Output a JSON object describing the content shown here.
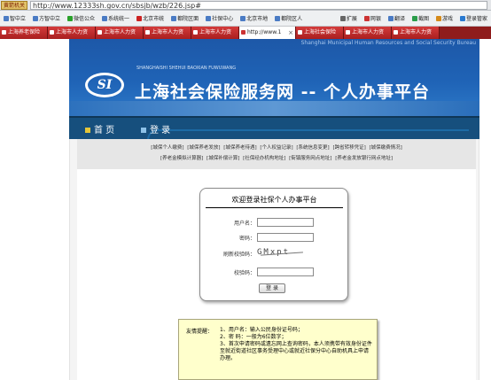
{
  "browser": {
    "badge": "黄箭机关",
    "url": "http://www.12333sh.gov.cn/sbsjb/wzb/226.jsp#"
  },
  "favorites": {
    "left": [
      "智中立",
      "方智中立",
      "微信公众",
      "系统统一",
      "北京市统",
      "都院区面",
      "社保中心",
      "北京市地",
      "都院区人"
    ],
    "right": [
      "扩展",
      "网银",
      "翻译",
      "截图",
      "游戏",
      "登录管家"
    ]
  },
  "tabs": [
    {
      "label": "上海养老保险"
    },
    {
      "label": "上海市人力资"
    },
    {
      "label": "上海市人力资"
    },
    {
      "label": "上海市人力资"
    },
    {
      "label": "上海市人力资"
    },
    {
      "label": "http://www.1"
    },
    {
      "label": "上海社会保险"
    },
    {
      "label": "上海市人力资"
    },
    {
      "label": "上海市人力资"
    }
  ],
  "banner": {
    "english": "Shanghai Municipal Human Resources and Social Security Bureau",
    "small": "SHANGHAISHI SHEHUI BAOXIAN FUWUWANG",
    "logo": "SI",
    "title": "上海社会保险服务网 -- 个人办事平台"
  },
  "nav": {
    "home": "首 页",
    "login": "登 录"
  },
  "links": {
    "row1": [
      "[城保个人缴费]",
      "[城保养老发放]",
      "[城保养老待遇]",
      "[个人权益记录]",
      "[系统信息变更]",
      "[跨省转移凭证]",
      "[城保缴费情况]"
    ],
    "row2": [
      "[养老金模拟计算器]",
      "[城保补偿计算]",
      "[社保经办机构地址]",
      "[街镇服务网点地址]",
      "[养老金发放银行网点地址]"
    ]
  },
  "login": {
    "heading": "欢迎登录社保个人办事平台",
    "username_label": "用户名：",
    "password_label": "密码：",
    "refresh_label": "刷新校验码：",
    "captcha": "GMxpt",
    "verify_label": "校验码：",
    "button": "登 录"
  },
  "tips": {
    "label": "友情提醒：",
    "lines": [
      "1、用户名：输入公民身份证号码；",
      "2、密  码：一般为6位数字；",
      "3、首次申请密码或遗忘网上查询密码，本人须携带有效身份证件至就近街道社区事务受理中心或就近社保分中心自助机具上申请办理。"
    ]
  }
}
